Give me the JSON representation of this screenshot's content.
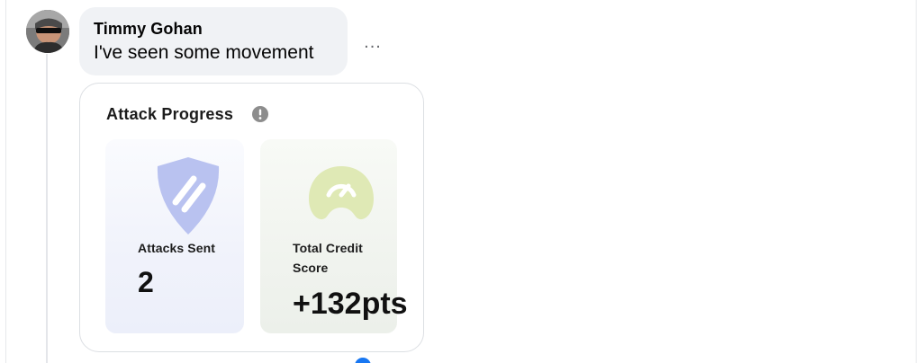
{
  "comment": {
    "author": "Timmy Gohan",
    "message": "I've seen some movement",
    "more_options": "..."
  },
  "card": {
    "title": "Attack Progress",
    "tiles": [
      {
        "label": "Attacks Sent",
        "value": "2",
        "icon": "shield-icon"
      },
      {
        "label": "Total Credit Score",
        "value": "+132pts",
        "icon": "gauge-icon"
      }
    ]
  },
  "colors": {
    "bubble": "#f0f2f5",
    "shield": "#b9c2f0",
    "gauge": "#dfe9b5",
    "accent_blue": "#1877f2"
  }
}
